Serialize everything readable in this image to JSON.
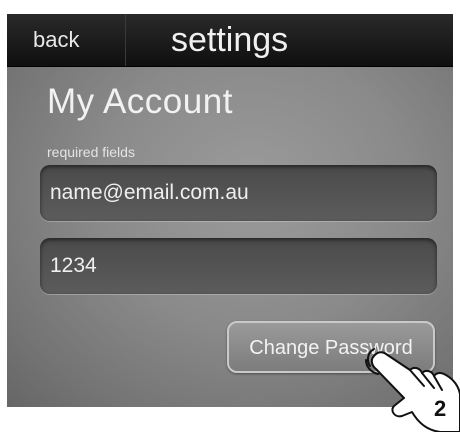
{
  "topbar": {
    "back_label": "back",
    "title": "settings"
  },
  "account": {
    "heading": "My Account",
    "required_label": "required fields",
    "email_value": "name@email.com.au",
    "password_value": "1234",
    "change_password_label": "Change Password"
  },
  "callout": {
    "step_number": "2",
    "icon": "tap-hand-icon"
  },
  "colors": {
    "topbar_bg": "#151515",
    "screen_bg": "#8a8a8a",
    "field_bg": "#525252",
    "text": "#f0f0f0"
  }
}
